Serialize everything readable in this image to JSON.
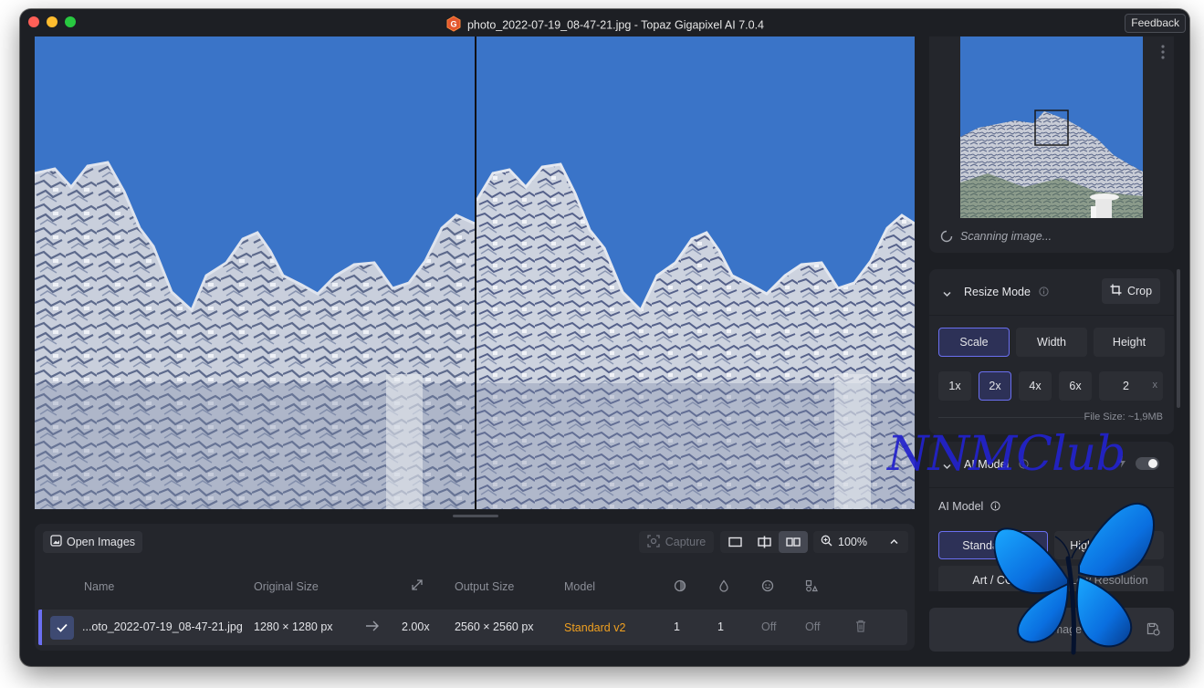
{
  "window": {
    "title": "photo_2022-07-19_08-47-21.jpg - Topaz Gigapixel AI 7.0.4",
    "feedback_label": "Feedback"
  },
  "toolbar": {
    "open_images_label": "Open Images",
    "capture_label": "Capture",
    "zoom_level": "100%"
  },
  "table": {
    "headers": {
      "name": "Name",
      "original_size": "Original Size",
      "output_size": "Output Size",
      "model": "Model"
    },
    "rows": [
      {
        "name": "...oto_2022-07-19_08-47-21.jpg",
        "original_size": "1280 × 1280 px",
        "scale": "2.00x",
        "output_size": "2560 × 2560 px",
        "model": "Standard v2",
        "val1": "1",
        "val2": "1",
        "val3": "Off",
        "val4": "Off"
      }
    ]
  },
  "navigator": {
    "status": "Scanning image..."
  },
  "resize_mode": {
    "title": "Resize Mode",
    "crop_label": "Crop",
    "modes": [
      "Scale",
      "Width",
      "Height"
    ],
    "active_mode": "Scale",
    "multipliers": [
      "1x",
      "2x",
      "4x",
      "6x"
    ],
    "active_multiplier": "2x",
    "custom_value": "2",
    "custom_suffix": "x",
    "file_size": "File Size: ~1,9MB"
  },
  "ai_model": {
    "title": "AI Model",
    "sub_label": "AI Model",
    "models": [
      "Standard v2",
      "High Fidelity v2",
      "Art / CG",
      "Low Resolution"
    ],
    "active_model": "Standard v2"
  },
  "save": {
    "label": "Save image"
  },
  "watermark": {
    "text": "NNMClub"
  },
  "colors": {
    "accent": "#6b6ff2",
    "model_text": "#f0a020",
    "sky": "#3a74c8"
  }
}
